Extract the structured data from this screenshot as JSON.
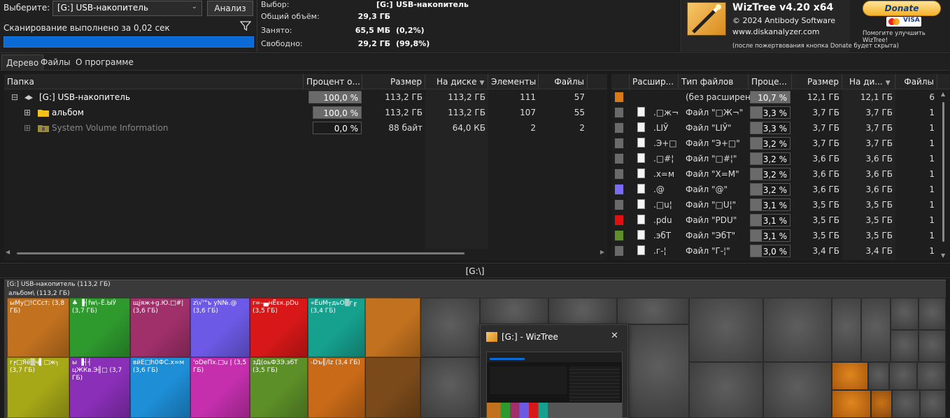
{
  "toolbar": {
    "select_label": "Выберите:",
    "drive": "[G:] USB-накопитель",
    "analyze": "Анализ",
    "scan_status": "Сканирование выполнено за 0,02 сек"
  },
  "info": {
    "selection_label": "Выбор:",
    "selection_value": "[G:]",
    "selection_name": "USB-накопитель",
    "total_label": "Общий объём:",
    "total_value": "29,3 ГБ",
    "used_label": "Занято:",
    "used_value": "65,5 МБ",
    "used_pct": "(0,2%)",
    "free_label": "Свободно:",
    "free_value": "29,2 ГБ",
    "free_pct": "(99,8%)"
  },
  "brand": {
    "title": "WizTree v4.20 x64",
    "copyright": "© 2024 Antibody Software",
    "site": "www.diskanalyzer.com",
    "donate": "Donate",
    "help": "Помогите улучшить WizTree!",
    "note": "(после пожертвования кнопка Donate будет скрыта)"
  },
  "tabs": [
    "Дерево",
    "Файлы",
    "О программе"
  ],
  "tree": {
    "headers": [
      "Папка",
      "Процент о...",
      "Размер",
      "На диске",
      "Элементы",
      "Файлы"
    ],
    "rows": [
      {
        "name": "[G:] USB-накопитель",
        "pct": "100,0 %",
        "pct_value": 100,
        "size": "113,2 ГБ",
        "disk": "113,2 ГБ",
        "items": "111",
        "files": "57"
      },
      {
        "name": "альбом",
        "pct": "100,0 %",
        "pct_value": 100,
        "size": "113,2 ГБ",
        "disk": "113,2 ГБ",
        "items": "107",
        "files": "55"
      },
      {
        "name": "System Volume Information",
        "pct": "0,0 %",
        "pct_value": 0,
        "size": "88 байт",
        "disk": "64,0 КБ",
        "items": "2",
        "files": "2"
      }
    ]
  },
  "ext": {
    "headers": [
      "Расшир...",
      "Тип файлов",
      "Проце...",
      "Размер",
      "На ди...",
      "Файлы"
    ],
    "rows": [
      {
        "color": "#d87a1a",
        "ext": "",
        "type": "(без расширени",
        "pct": "10,7 %",
        "pct_value": 10.7,
        "size": "12,1 ГБ",
        "disk": "12,1 ГБ",
        "files": "6"
      },
      {
        "color": "#6a6a6a",
        "ext": ".□ж¬",
        "type": "Файл \"□Ж¬\"",
        "pct": "3,3 %",
        "pct_value": 3.3,
        "size": "3,7 ГБ",
        "disk": "3,7 ГБ",
        "files": "1"
      },
      {
        "color": "#6a6a6a",
        "ext": ".LІЎ",
        "type": "Файл \"LІЎ\"",
        "pct": "3,3 %",
        "pct_value": 3.3,
        "size": "3,7 ГБ",
        "disk": "3,7 ГБ",
        "files": "1"
      },
      {
        "color": "#6a6a6a",
        "ext": ".Э+□",
        "type": "Файл \"Э+□\"",
        "pct": "3,2 %",
        "pct_value": 3.2,
        "size": "3,7 ГБ",
        "disk": "3,7 ГБ",
        "files": "1"
      },
      {
        "color": "#6a6a6a",
        "ext": ".□#¦",
        "type": "Файл \"□#¦\"",
        "pct": "3,2 %",
        "pct_value": 3.2,
        "size": "3,6 ГБ",
        "disk": "3,6 ГБ",
        "files": "1"
      },
      {
        "color": "#6a6a6a",
        "ext": ".x=м",
        "type": "Файл \"X=M\"",
        "pct": "3,2 %",
        "pct_value": 3.2,
        "size": "3,6 ГБ",
        "disk": "3,6 ГБ",
        "files": "1"
      },
      {
        "color": "#7a6cf2",
        "ext": ".@",
        "type": "Файл \"@\"",
        "pct": "3,2 %",
        "pct_value": 3.2,
        "size": "3,6 ГБ",
        "disk": "3,6 ГБ",
        "files": "1"
      },
      {
        "color": "#6a6a6a",
        "ext": ".□u¦",
        "type": "Файл \"□U¦\"",
        "pct": "3,1 %",
        "pct_value": 3.1,
        "size": "3,5 ГБ",
        "disk": "3,5 ГБ",
        "files": "1"
      },
      {
        "color": "#e01010",
        "ext": ".pdu",
        "type": "Файл \"PDU\"",
        "pct": "3,1 %",
        "pct_value": 3.1,
        "size": "3,5 ГБ",
        "disk": "3,5 ГБ",
        "files": "1"
      },
      {
        "color": "#5e8f2c",
        "ext": ".эбТ",
        "type": "Файл \"ЭбТ\"",
        "pct": "3,1 %",
        "pct_value": 3.1,
        "size": "3,5 ГБ",
        "disk": "3,5 ГБ",
        "files": "1"
      },
      {
        "color": "#6a6a6a",
        "ext": ".г-¦",
        "type": "Файл \"Г-¦\"",
        "pct": "3,0 %",
        "pct_value": 3.0,
        "size": "3,4 ГБ",
        "disk": "3,4 ГБ",
        "files": "1"
      }
    ]
  },
  "path": "[G:\\]",
  "treemap": {
    "root": "[G:] USB-накопитель (113,2 ГБ)",
    "folder": "альбом\\ (113,2 ГБ)",
    "blocks": [
      {
        "label": "ыМу□!ССс†: (3,8 ГБ)",
        "color": "#c2721f"
      },
      {
        "label": "♣ ▐┤fw\\–Ё.ЫЎ (3,7 ГБ)",
        "color": "#2e9a2e"
      },
      {
        "label": "щjяж+g.Ю.□#| (3,6 ГБ)",
        "color": "#a0306a"
      },
      {
        "label": "z\\√'\"ъ yN№.@ (3,6 ГБ)",
        "color": "#6c5ae6"
      },
      {
        "label": "r=–▄нЁєк.pDu (3,5 ГБ)",
        "color": "#d81818"
      },
      {
        "label": "«ЁuМ┬дьO▒г╓ (3,4 ГБ)",
        "color": "#16a08e"
      },
      {
        "label": "",
        "color": "#c2721f"
      },
      {
        "label": "r╒□Яё▒ч▌□ж┐ (3,7 ГБ)",
        "color": "#a6a818"
      },
      {
        "label": "ы ▐┤┤ цЖКв.Э╢□ (3,7 ГБ)",
        "color": "#8a2fb8"
      },
      {
        "label": "вйЕ□h0ФС.х=м (3,6 ГБ)",
        "color": "#1e8ed6"
      },
      {
        "label": "'оDеПх.□u | (3,5 ГБ)",
        "color": "#c52fae"
      },
      {
        "label": "зД(оьФЗЭ.эбТ (3,5 ГБ)",
        "color": "#5c8f28"
      },
      {
        "label": "-Dъ╢/lz (3,4 ГБ)",
        "color": "#c86a18"
      },
      {
        "label": "",
        "color": "#7a4a1a"
      }
    ]
  },
  "popup": {
    "title": "[G:]  - WizTree",
    "close": "✕"
  }
}
